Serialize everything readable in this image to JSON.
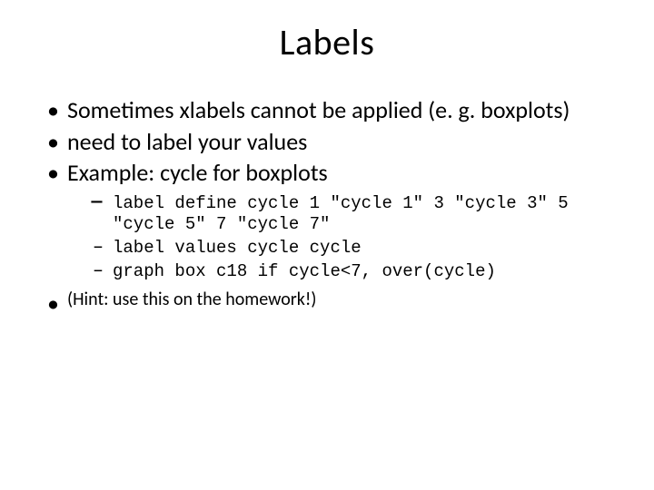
{
  "slide": {
    "title": "Labels",
    "bullets": {
      "b0": "Sometimes xlabels cannot be applied (e. g. boxplots)",
      "b1": "need to label your values",
      "b2": "Example:  cycle for boxplots",
      "b3": "(Hint:  use this on the homework!)"
    },
    "code": {
      "c0": "label define cycle 1 \"cycle 1\" 3 \"cycle 3\" 5 \"cycle 5\" 7 \"cycle 7\"",
      "c1": "label values cycle cycle",
      "c2": "graph box c18 if cycle<7, over(cycle)"
    }
  }
}
